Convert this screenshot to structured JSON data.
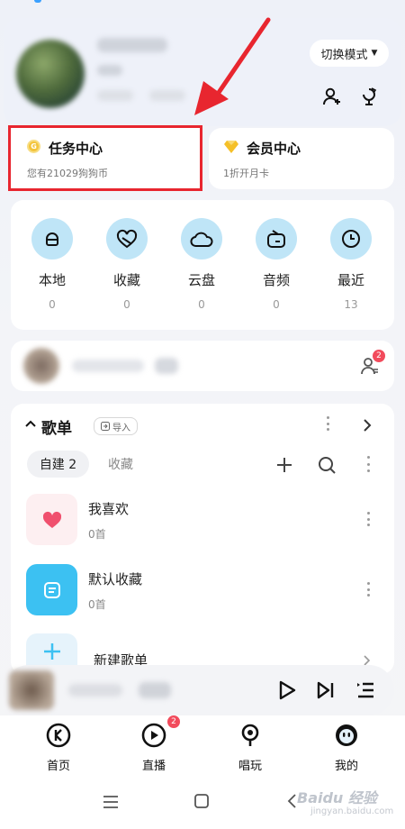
{
  "header": {
    "mode_label": "切换模式"
  },
  "task_card": {
    "title": "任务中心",
    "subtitle": "您有21029狗狗币",
    "coin_icon": "coin-icon"
  },
  "vip_card": {
    "title": "会员中心",
    "subtitle": "1折开月卡",
    "icon": "diamond-icon"
  },
  "quick_access": [
    {
      "label": "本地",
      "count": "0",
      "icon": "local-music-icon"
    },
    {
      "label": "收藏",
      "count": "0",
      "icon": "heart-icon"
    },
    {
      "label": "云盘",
      "count": "0",
      "icon": "cloud-icon"
    },
    {
      "label": "音频",
      "count": "0",
      "icon": "radio-icon"
    },
    {
      "label": "最近",
      "count": "13",
      "icon": "clock-icon"
    }
  ],
  "friend": {
    "badge": "2"
  },
  "playlists": {
    "title": "歌单",
    "import_label": "导入",
    "tabs": [
      {
        "label": "自建 2",
        "active": true
      },
      {
        "label": "收藏",
        "active": false
      }
    ],
    "items": [
      {
        "name": "我喜欢",
        "count": "0首",
        "color": "#fdeff1",
        "icon": "heart-icon"
      },
      {
        "name": "默认收藏",
        "count": "0首",
        "color": "#3cc1f2",
        "icon": "note-icon"
      }
    ],
    "new_label": "新建歌单"
  },
  "tabbar": [
    {
      "label": "首页",
      "icon": "kugou-logo-icon"
    },
    {
      "label": "直播",
      "icon": "live-play-icon",
      "badge": "2"
    },
    {
      "label": "唱玩",
      "icon": "microphone-icon"
    },
    {
      "label": "我的",
      "icon": "profile-face-icon"
    }
  ],
  "watermark": {
    "main": "Baidu 经验",
    "sub": "jingyan.baidu.com"
  },
  "colors": {
    "accent_red": "#e8262f",
    "circle_blue": "#bfe5f7",
    "badge_red": "#f24b5c"
  }
}
